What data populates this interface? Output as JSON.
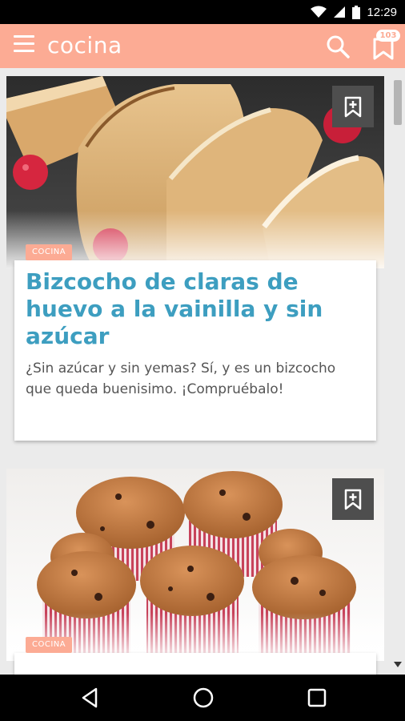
{
  "status_bar": {
    "time": "12:29"
  },
  "app_bar": {
    "title": "cocina",
    "bookmarks_count": "103"
  },
  "cards": [
    {
      "category": "COCINA",
      "title": "Bizcocho de claras de huevo a la vainilla y sin azúcar",
      "description": "¿Sin azúcar y sin yemas? Sí, y es un bizcocho que queda buenisimo. ¡Compruébalo!",
      "image": "sponge-cake-slices"
    },
    {
      "category": "COCINA",
      "title": "",
      "description": "",
      "image": "muffins"
    }
  ],
  "icons": [
    "menu-icon",
    "search-icon",
    "bookmarks-icon",
    "bookmark-add-icon",
    "back-icon",
    "home-icon",
    "recents-icon",
    "wifi-icon",
    "signal-icon",
    "battery-icon"
  ],
  "colors": {
    "accent": "#fcab94",
    "title": "#3d9ec0",
    "save_button": "#4e4e4e"
  }
}
